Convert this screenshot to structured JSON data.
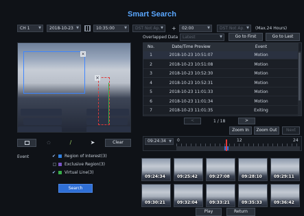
{
  "title": "Smart Search",
  "toolbar": {
    "channel": "CH 1",
    "date": "2018-10-23",
    "start_time": "10:35:00",
    "dst_start": "DST Not Ap.",
    "plus": "+",
    "duration": "02:00",
    "dst_end": "DST Not Ap.",
    "max_hours": "(Max.24 Hours)",
    "overlapped_label": "Overlapped Data",
    "overlapped_value": "Latest",
    "go_first": "Go to First",
    "go_last": "Go to Last"
  },
  "table": {
    "headers": [
      "No.",
      "Date/Time Preview",
      "Event"
    ],
    "rows": [
      {
        "no": "1",
        "time": "2018-10-23 10:51:07",
        "event": "Motion"
      },
      {
        "no": "2",
        "time": "2018-10-23 10:51:08",
        "event": "Motion"
      },
      {
        "no": "3",
        "time": "2018-10-23 10:52:30",
        "event": "Motion"
      },
      {
        "no": "4",
        "time": "2018-10-23 10:52:31",
        "event": "Motion"
      },
      {
        "no": "5",
        "time": "2018-10-23 11:01:33",
        "event": "Motion"
      },
      {
        "no": "6",
        "time": "2018-10-23 11:01:34",
        "event": "Motion"
      },
      {
        "no": "7",
        "time": "2018-10-23 11:01:35",
        "event": "Exiting"
      }
    ]
  },
  "pager": {
    "prev": "<",
    "status": "1 / 18",
    "next": ">"
  },
  "zoom": {
    "in": "Zoom In",
    "out": "Zoom Out",
    "next": "Next"
  },
  "timeline": {
    "current": "09:24:34",
    "ticks": [
      "0",
      "12",
      "24"
    ]
  },
  "tools": {
    "clear": "Clear"
  },
  "event": {
    "label": "Event",
    "options": [
      {
        "label": "Region of Interest(3)",
        "color": "#2f7fe0",
        "checked": true
      },
      {
        "label": "Exclusive Region(3)",
        "color": "#7a55c8",
        "checked": false
      },
      {
        "label": "Virtual Line(3)",
        "color": "#38b04a",
        "checked": true
      }
    ]
  },
  "search_label": "Search",
  "thumbnails": [
    "09:24:34",
    "09:25:42",
    "09:27:08",
    "09:28:10",
    "09:29:11",
    "09:30:21",
    "09:32:04",
    "09:33:21",
    "09:35:33",
    "09:36:42"
  ],
  "bottom": {
    "play": "Play",
    "return": "Return"
  },
  "colors": {
    "accent": "#2f6fd6",
    "title": "#5aa7ff",
    "roi": "#2f7fe0",
    "exclusive": "#7a55c8",
    "virtual_line": "#38b04a",
    "marker": "#e23a3a"
  }
}
